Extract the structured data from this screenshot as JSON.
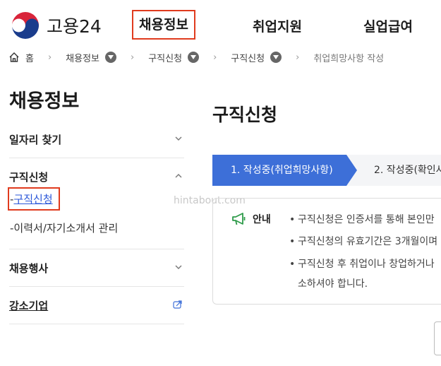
{
  "header": {
    "logo_text": "고용24",
    "nav": [
      {
        "label": "채용정보",
        "active": true
      },
      {
        "label": "취업지원",
        "active": false
      },
      {
        "label": "실업급여",
        "active": false
      }
    ]
  },
  "breadcrumb": {
    "home": "홈",
    "items": [
      "채용정보",
      "구직신청",
      "구직신청"
    ],
    "current": "취업희망사항 작성"
  },
  "sidebar": {
    "title": "채용정보",
    "sections": [
      {
        "label": "일자리 찾기",
        "expanded": false
      },
      {
        "label": "구직신청",
        "expanded": true,
        "items": [
          {
            "label": "구직신청",
            "active": true
          },
          {
            "label": "이력서/자기소개서 관리",
            "active": false
          }
        ]
      },
      {
        "label": "채용행사",
        "expanded": false
      },
      {
        "label": "강소기업",
        "external": true
      }
    ]
  },
  "main": {
    "title": "구직신청",
    "steps": [
      {
        "label": "1. 작성중(취업희망사항)",
        "active": true
      },
      {
        "label": "2. 작성중(확인사",
        "active": false
      }
    ],
    "notice": {
      "label": "안내",
      "lines": [
        "구직신청은 인증서를 통해 본인만",
        "구직신청의 유효기간은 3개월이며",
        "구직신청 후 취업이나 창업하거나",
        "소하셔야 합니다."
      ]
    }
  },
  "watermark": "hintabout.com",
  "colors": {
    "accent": "#3d6fd8",
    "highlight_box": "#e03b1e",
    "link": "#2b57d9"
  }
}
